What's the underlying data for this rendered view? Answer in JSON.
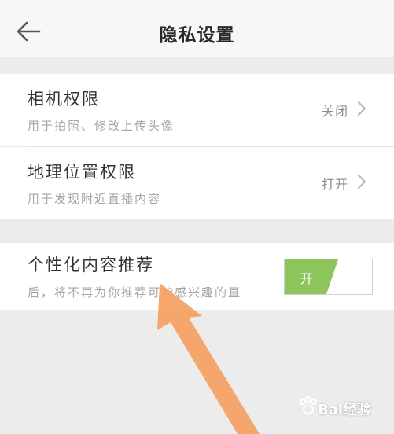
{
  "header": {
    "title": "隐私设置",
    "back_icon": "arrow-left-icon"
  },
  "permissions": [
    {
      "title": "相机权限",
      "subtitle": "用于拍照、修改上传头像",
      "value": "关闭"
    },
    {
      "title": "地理位置权限",
      "subtitle": "用于发现附近直播内容",
      "value": "打开"
    }
  ],
  "personalization": {
    "title": "个性化内容推荐",
    "subtitle": "后，将不再为你推荐可能感兴趣的直",
    "toggle_label": "开",
    "toggle_on": true
  },
  "watermark": {
    "text": "Bai经验"
  },
  "colors": {
    "toggle_green": "#8ec45c",
    "annotation_arrow": "#f5a265",
    "background": "#ececec"
  }
}
